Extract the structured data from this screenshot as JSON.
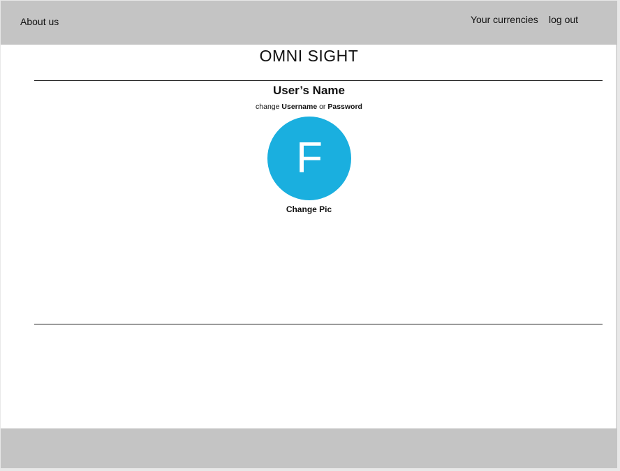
{
  "header": {
    "about_label": "About us",
    "currencies_label": "Your currencies",
    "logout_label": "log out"
  },
  "main": {
    "title": "OMNI SIGHT",
    "user_name": "User’s Name",
    "change_prefix": "change",
    "username_link": "Username",
    "or_text": "or",
    "password_link": "Password",
    "avatar_letter": "F",
    "change_pic_label": "Change Pic"
  },
  "colors": {
    "bar": "#c4c4c4",
    "avatar": "#1aafdf"
  }
}
